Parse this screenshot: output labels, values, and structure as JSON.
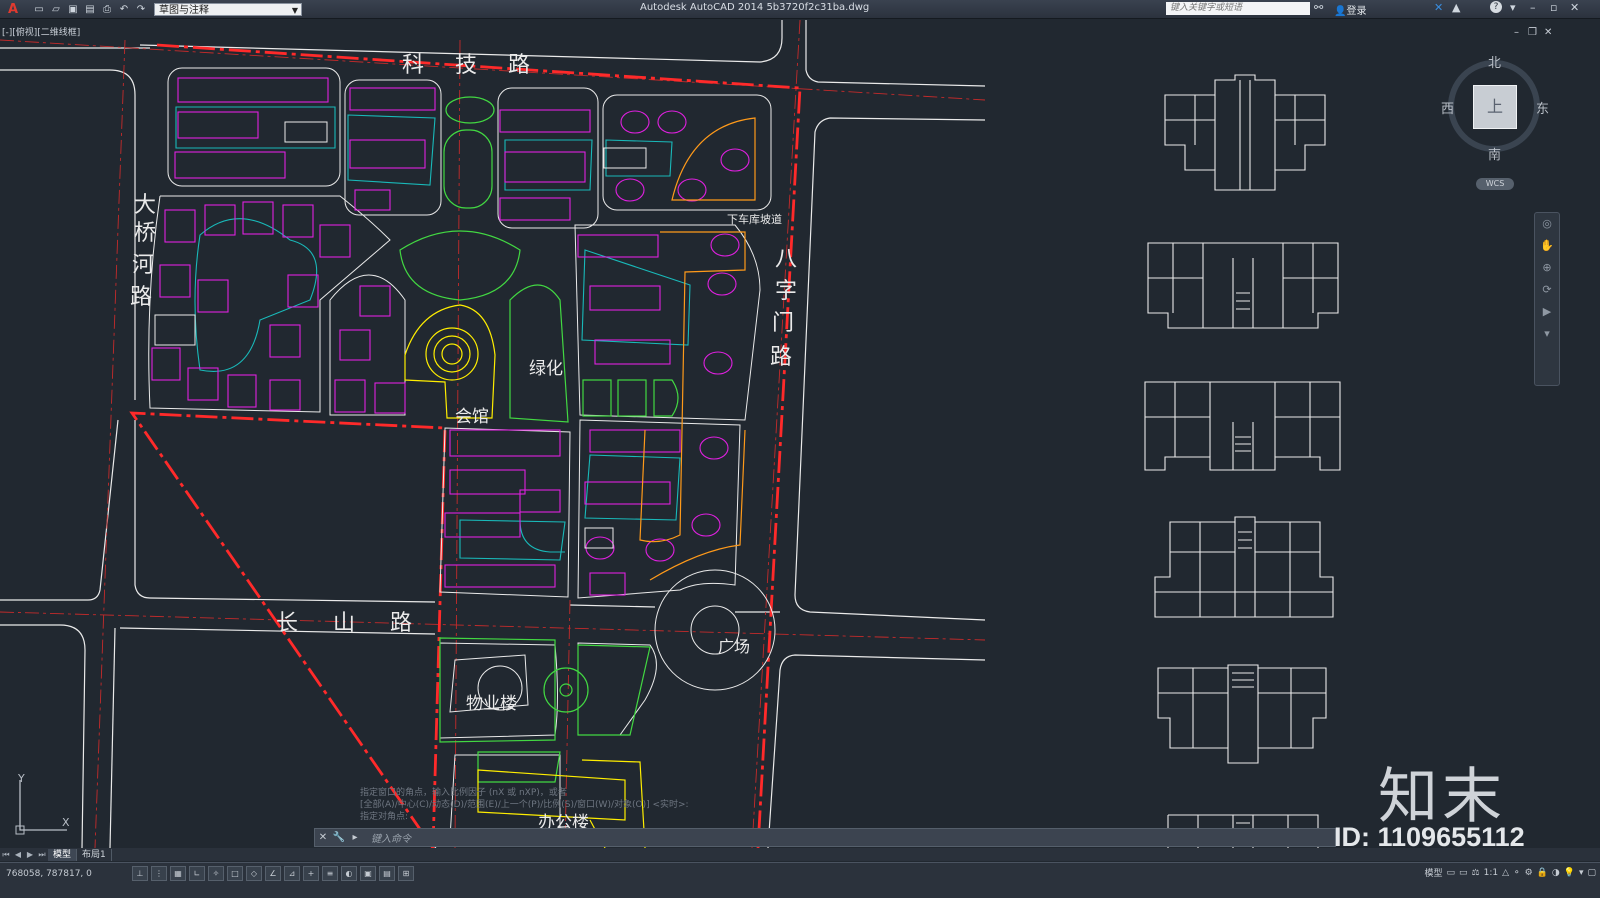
{
  "app": {
    "logo": "A",
    "title": "Autodesk AutoCAD 2014    5b3720f2c31ba.dwg",
    "workspace": "草图与注释",
    "search_placeholder": "键入关键字或短语",
    "login_label": "登录",
    "help_label": "?"
  },
  "quick_access": [
    "new-icon",
    "open-icon",
    "save-icon",
    "saveas-icon",
    "plot-icon",
    "undo-icon",
    "redo-icon"
  ],
  "viewport": {
    "label": "[-][俯视][二维线框]",
    "window_controls": [
      "–",
      "❐",
      "✕"
    ]
  },
  "drawing": {
    "roads": {
      "top": "科 技 路",
      "left": [
        "大",
        "桥",
        "河",
        "路"
      ],
      "right": [
        "八",
        "字",
        "门",
        "路"
      ],
      "middle": "长 山 路"
    },
    "labels": {
      "ramp": "下车库坡道",
      "green": "绿化",
      "clubhouse": "会馆",
      "plaza": "广场",
      "property": "物业楼",
      "office": "办公楼"
    },
    "colors": {
      "boundary": "#ff2a2a",
      "residential": "#e020e0",
      "landscape_cyan": "#19b9b9",
      "landscape_green": "#42d842",
      "yellow": "#ffee00",
      "orange": "#ff9a1a",
      "white": "#eaeaea",
      "axis_red": "#c42b2b"
    }
  },
  "viewcube": {
    "north": "北",
    "south": "南",
    "east": "东",
    "west": "西",
    "face": "上",
    "wcs": "WCS"
  },
  "ucs": {
    "x": "X",
    "y": "Y"
  },
  "command": {
    "history": [
      "指定窗口的角点，输入比例因子 (nX 或 nXP)，或者",
      "[全部(A)/中心(C)/动态(D)/范围(E)/上一个(P)/比例(S)/窗口(W)/对象(O)] <实时>:",
      "指定对角点:"
    ],
    "input_placeholder": "键入命令"
  },
  "layout_tabs": [
    "模型",
    "布局1"
  ],
  "status": {
    "coords": "768058,  787817,  0",
    "right_labels": [
      "模型",
      "1:1"
    ]
  },
  "watermark": {
    "logo": "知末",
    "id": "ID: 1109655112"
  }
}
